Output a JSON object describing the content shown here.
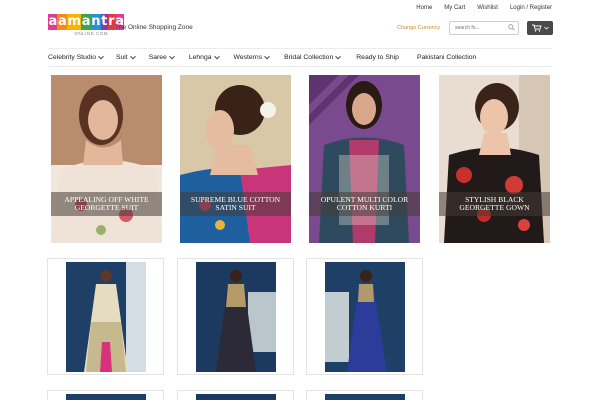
{
  "top_links": [
    "Home",
    "My Cart",
    "Wishlist",
    "Login / Register"
  ],
  "logo": {
    "letters": [
      "a",
      "a",
      "m",
      "a",
      "n",
      "t",
      "r",
      "a"
    ],
    "colors": [
      "#e23a8c",
      "#f28a1d",
      "#f4b400",
      "#3aa64a",
      "#2a8fd8",
      "#7b3fb8",
      "#e23a3a",
      "#e23a8c"
    ],
    "sub": "ONLINE.COM"
  },
  "tagline": "The Online Shopping Zone",
  "currency_label": "Change Currency",
  "search": {
    "placeholder": "search fo..."
  },
  "icons": {
    "search": "search-icon",
    "cart": "cart-icon",
    "dropdown": "chevron-down-icon"
  },
  "nav": [
    {
      "label": "Celebrity Studio",
      "dropdown": true
    },
    {
      "label": "Suit",
      "dropdown": true
    },
    {
      "label": "Saree",
      "dropdown": true
    },
    {
      "label": "Lehnga",
      "dropdown": true
    },
    {
      "label": "Westerns",
      "dropdown": true
    },
    {
      "label": "Bridal Collection",
      "dropdown": true
    },
    {
      "label": "Ready to Ship",
      "dropdown": false
    },
    {
      "label": "Pakistani Collection",
      "dropdown": false
    }
  ],
  "featured": [
    {
      "caption": "APPEALING OFF WHITE GEORGETTE SUIT"
    },
    {
      "caption": "SUPREME BLUE COTTON SATIN SUIT"
    },
    {
      "caption": "OPULENT MULTI COLOR COTTON KURTI"
    },
    {
      "caption": "STYLISH BLACK GEORGETTE GOWN"
    }
  ],
  "accent_color": "#d08a2a"
}
